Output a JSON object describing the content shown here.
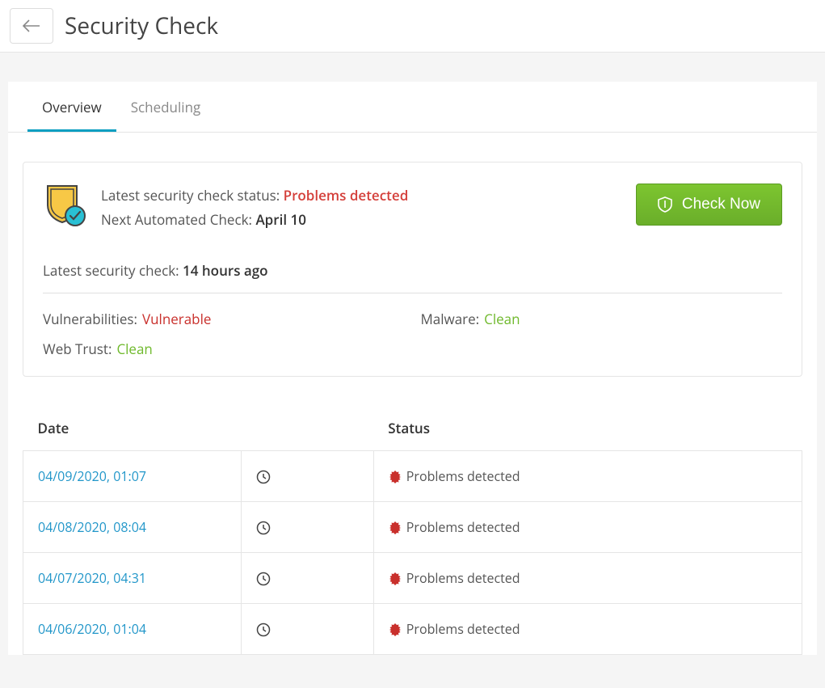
{
  "header": {
    "title": "Security Check"
  },
  "tabs": [
    {
      "label": "Overview",
      "active": true
    },
    {
      "label": "Scheduling",
      "active": false
    }
  ],
  "status": {
    "latest_label": "Latest security check status:",
    "latest_value": "Problems detected",
    "next_label": "Next Automated Check:",
    "next_value": "April 10",
    "check_now_label": "Check Now",
    "last_check_label": "Latest security check:",
    "last_check_value": "14 hours ago"
  },
  "metrics": {
    "vuln_label": "Vulnerabilities:",
    "vuln_value": "Vulnerable",
    "malware_label": "Malware:",
    "malware_value": "Clean",
    "webtrust_label": "Web Trust:",
    "webtrust_value": "Clean"
  },
  "table": {
    "header_date": "Date",
    "header_status": "Status",
    "rows": [
      {
        "date": "04/09/2020, 01:07",
        "status": "Problems detected"
      },
      {
        "date": "04/08/2020, 08:04",
        "status": "Problems detected"
      },
      {
        "date": "04/07/2020, 04:31",
        "status": "Problems detected"
      },
      {
        "date": "04/06/2020, 01:04",
        "status": "Problems detected"
      }
    ]
  }
}
